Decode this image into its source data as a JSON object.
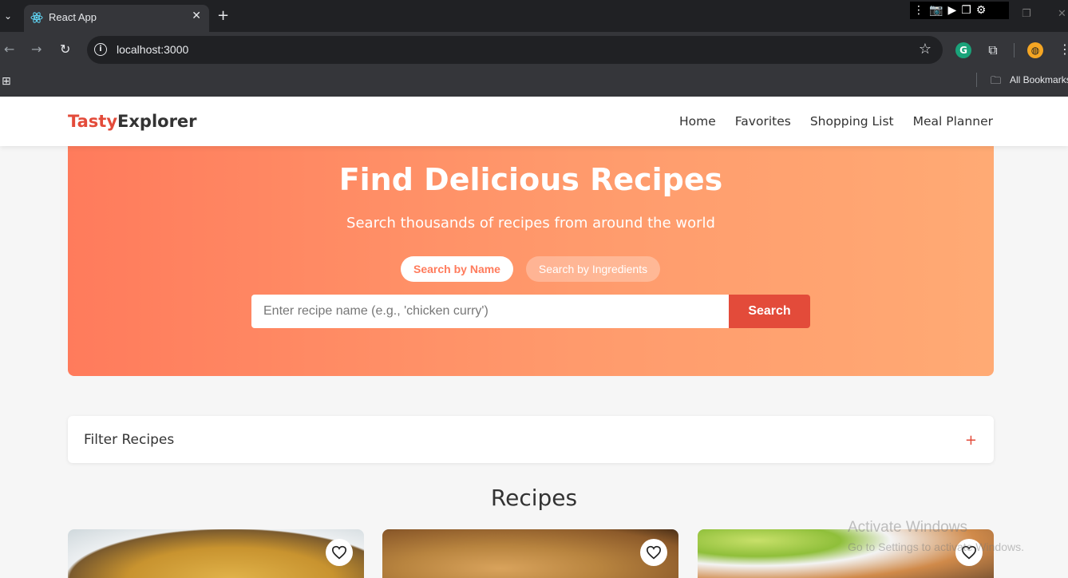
{
  "browser": {
    "tab_title": "React App",
    "url": "localhost:3000",
    "bookmarks_label": "All Bookmarks"
  },
  "app": {
    "logo_part1": "Tasty",
    "logo_part2": "Explorer",
    "nav": [
      "Home",
      "Favorites",
      "Shopping List",
      "Meal Planner"
    ]
  },
  "hero": {
    "title": "Find Delicious Recipes",
    "subtitle": "Search thousands of recipes from around the world",
    "toggle_name": "Search by Name",
    "toggle_ingredients": "Search by Ingredients",
    "search_placeholder": "Enter recipe name (e.g., 'chicken curry')",
    "search_button": "Search"
  },
  "filter": {
    "title": "Filter Recipes",
    "toggle_symbol": "+"
  },
  "recipes": {
    "title": "Recipes"
  },
  "watermark": {
    "line1": "Activate Windows",
    "line2": "Go to Settings to activate Windows."
  },
  "colors": {
    "accent": "#e34b3a",
    "hero_start": "#ff7b5c",
    "hero_end": "#ffaa74"
  }
}
